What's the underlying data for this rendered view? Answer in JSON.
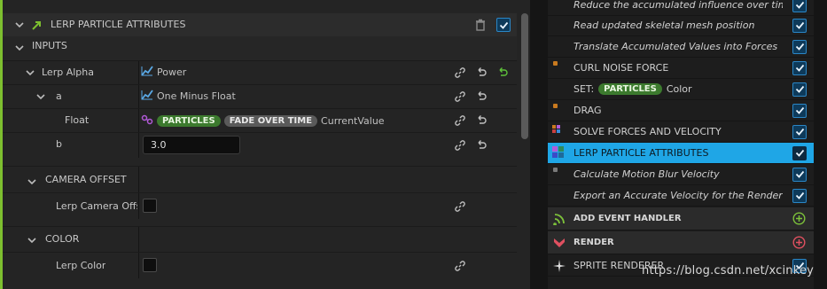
{
  "left_panel": {
    "header_title": "LERP PARTICLE ATTRIBUTES",
    "inputs_label": "INPUTS",
    "rows": [
      {
        "label": "Lerp Alpha",
        "value": "Power"
      },
      {
        "label": "a",
        "value": "One Minus Float"
      },
      {
        "label": "Float",
        "pills": [
          "PARTICLES",
          "FADE OVER TIME"
        ],
        "value": "CurrentValue"
      },
      {
        "label": "b",
        "value": "3.0"
      }
    ],
    "camera_offset": {
      "header": "CAMERA OFFSET",
      "row_label": "Lerp Camera Offs"
    },
    "color": {
      "header": "COLOR",
      "row_label": "Lerp Color"
    }
  },
  "stack": {
    "items": [
      {
        "label": "Reduce the accumulated influence over time",
        "style": "italic",
        "checked": true
      },
      {
        "label": "Read updated skeletal mesh position",
        "style": "italic",
        "checked": true
      },
      {
        "label": "Translate Accumulated Values into Forces",
        "style": "italic",
        "checked": true
      },
      {
        "label": "CURL NOISE FORCE",
        "style": "caps",
        "checked": true,
        "dot": "#c97a1f"
      },
      {
        "label": "SET:",
        "pill": "PARTICLES",
        "suffix": "Color",
        "style": "set",
        "checked": true
      },
      {
        "label": "DRAG",
        "style": "caps",
        "checked": true,
        "dot": "#c97a1f"
      },
      {
        "label": "SOLVE FORCES AND VELOCITY",
        "style": "caps",
        "checked": true,
        "dot": "multi"
      },
      {
        "label": "LERP PARTICLE ATTRIBUTES",
        "style": "caps",
        "checked": true,
        "selected": true
      },
      {
        "label": "Calculate Motion Blur Velocity",
        "style": "italic",
        "checked": true,
        "dot": "#7a7a7a"
      },
      {
        "label": "Export an Accurate Velocity for the Renderer",
        "style": "italic",
        "checked": true
      }
    ],
    "sections": [
      {
        "label": "ADD EVENT HANDLER",
        "icon": "event-handler-icon",
        "color": "#7dc23a"
      },
      {
        "label": "RENDER",
        "icon": "render-icon",
        "color": "#e05060"
      }
    ],
    "last_item": {
      "label": "SPRITE RENDERER",
      "checked": true
    }
  },
  "watermark": "https://blog.csdn.net/xcinkey",
  "colors": {
    "accent_green": "#7dbf2f",
    "selection_blue": "#1fa6e6",
    "checkbox_blue": "#2a86c6"
  }
}
